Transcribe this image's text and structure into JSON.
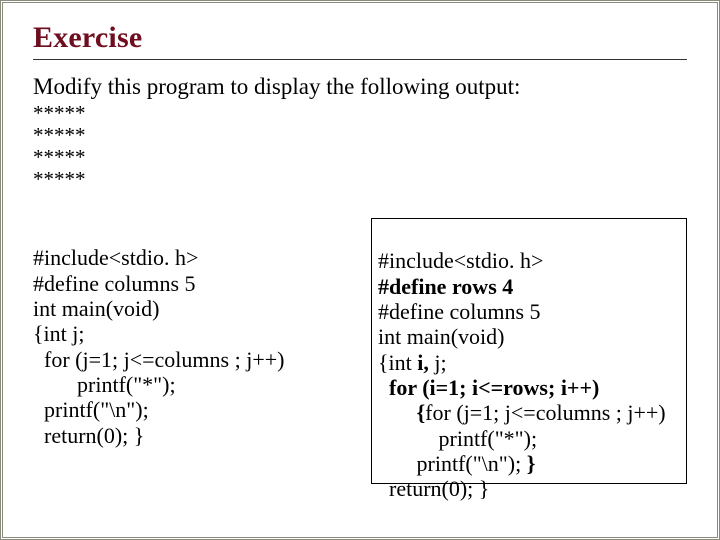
{
  "title": "Exercise",
  "prompt": "Modify this program to display the following output:",
  "output": {
    "rows": [
      "*****",
      "*****",
      "*****",
      "*****"
    ]
  },
  "left": {
    "l1": "#include<stdio. h>",
    "l2": "#define columns 5",
    "l3": "int main(void)",
    "l4": "{int j;",
    "l5": "  for (j=1; j<=columns ; j++)",
    "l6": "        printf(\"*\");",
    "l7": "  printf(\"\\n\");",
    "l8": "  return(0); }"
  },
  "right": {
    "l1": "#include<stdio. h>",
    "l2a": "#define rows 4",
    "l3": "#define columns 5",
    "l4": "int main(void)",
    "l5a_pre": "{int ",
    "l5a_bold": "i, ",
    "l5a_post": "j;",
    "l6a_pre": "  ",
    "l6a_bold": "for (i=1; i<=rows; i++)",
    "l7a_pre": "       ",
    "l7a_bold": "{",
    "l7a_post": "for (j=1; j<=columns ; j++)",
    "l8": "           printf(\"*\");",
    "l9a_pre": "       printf(\"\\n\"); ",
    "l9a_bold": "}",
    "l10": "  return(0); }"
  }
}
